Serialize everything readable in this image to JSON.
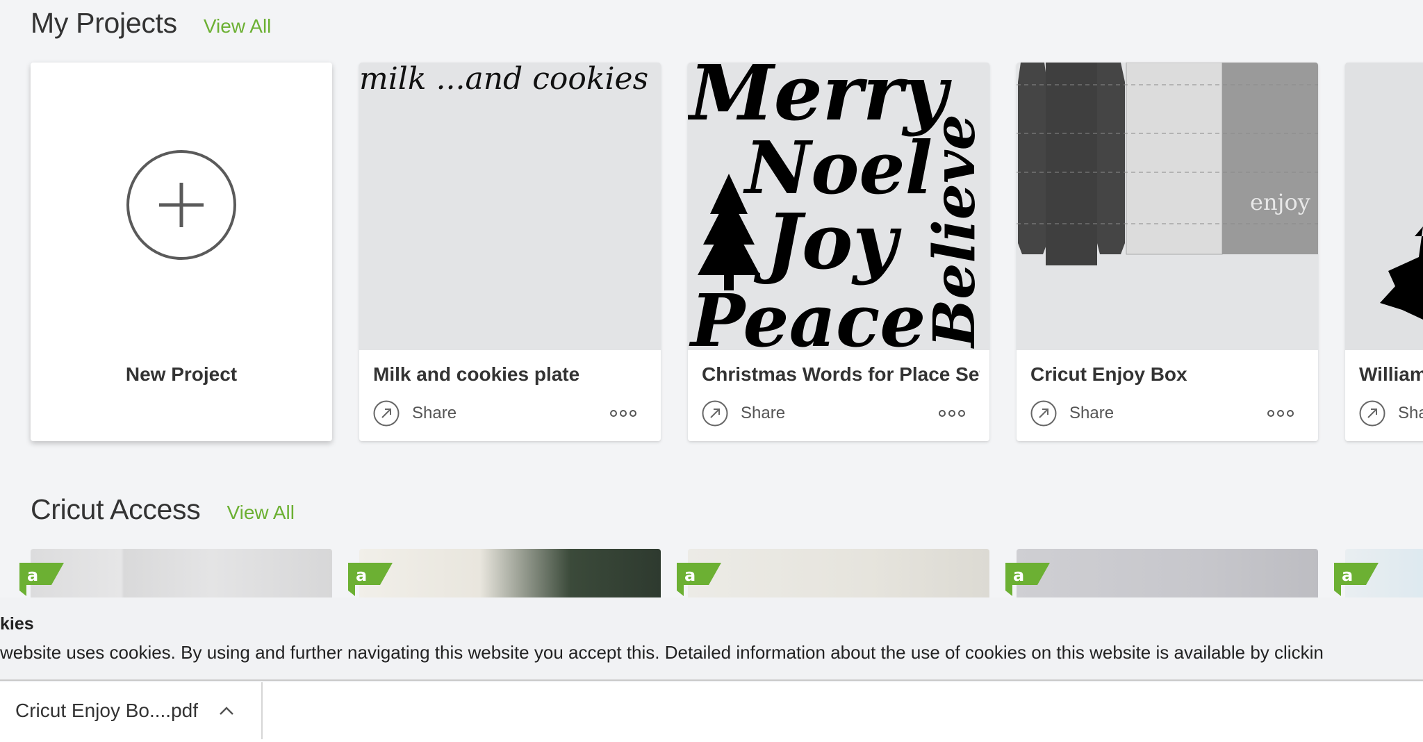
{
  "my_projects": {
    "title": "My Projects",
    "view_all": "View All",
    "new_project_label": "New Project",
    "cards": [
      {
        "title": "Milk and cookies plate",
        "share": "Share",
        "thumb_text": "milk ...and cookies"
      },
      {
        "title": "Christmas Words for Place Setti",
        "share": "Share",
        "thumb_words": [
          "Merry",
          "Noel",
          "Joy",
          "Peace",
          "Believe"
        ]
      },
      {
        "title": "Cricut Enjoy Box",
        "share": "Share",
        "thumb_text": "enjoy"
      },
      {
        "title": "William",
        "share": "Sha"
      }
    ]
  },
  "cricut_access": {
    "title": "Cricut Access",
    "view_all": "View All",
    "badge_letter": "a"
  },
  "cookie_banner": {
    "title": "kies",
    "text": "website uses cookies. By using and further navigating this website you accept this. Detailed information about the use of cookies on this website is available by clickin"
  },
  "download_bar": {
    "file_name": "Cricut Enjoy Bo....pdf"
  },
  "colors": {
    "accent": "#6cb033",
    "badge": "#6cb033",
    "background": "#f3f4f6"
  }
}
